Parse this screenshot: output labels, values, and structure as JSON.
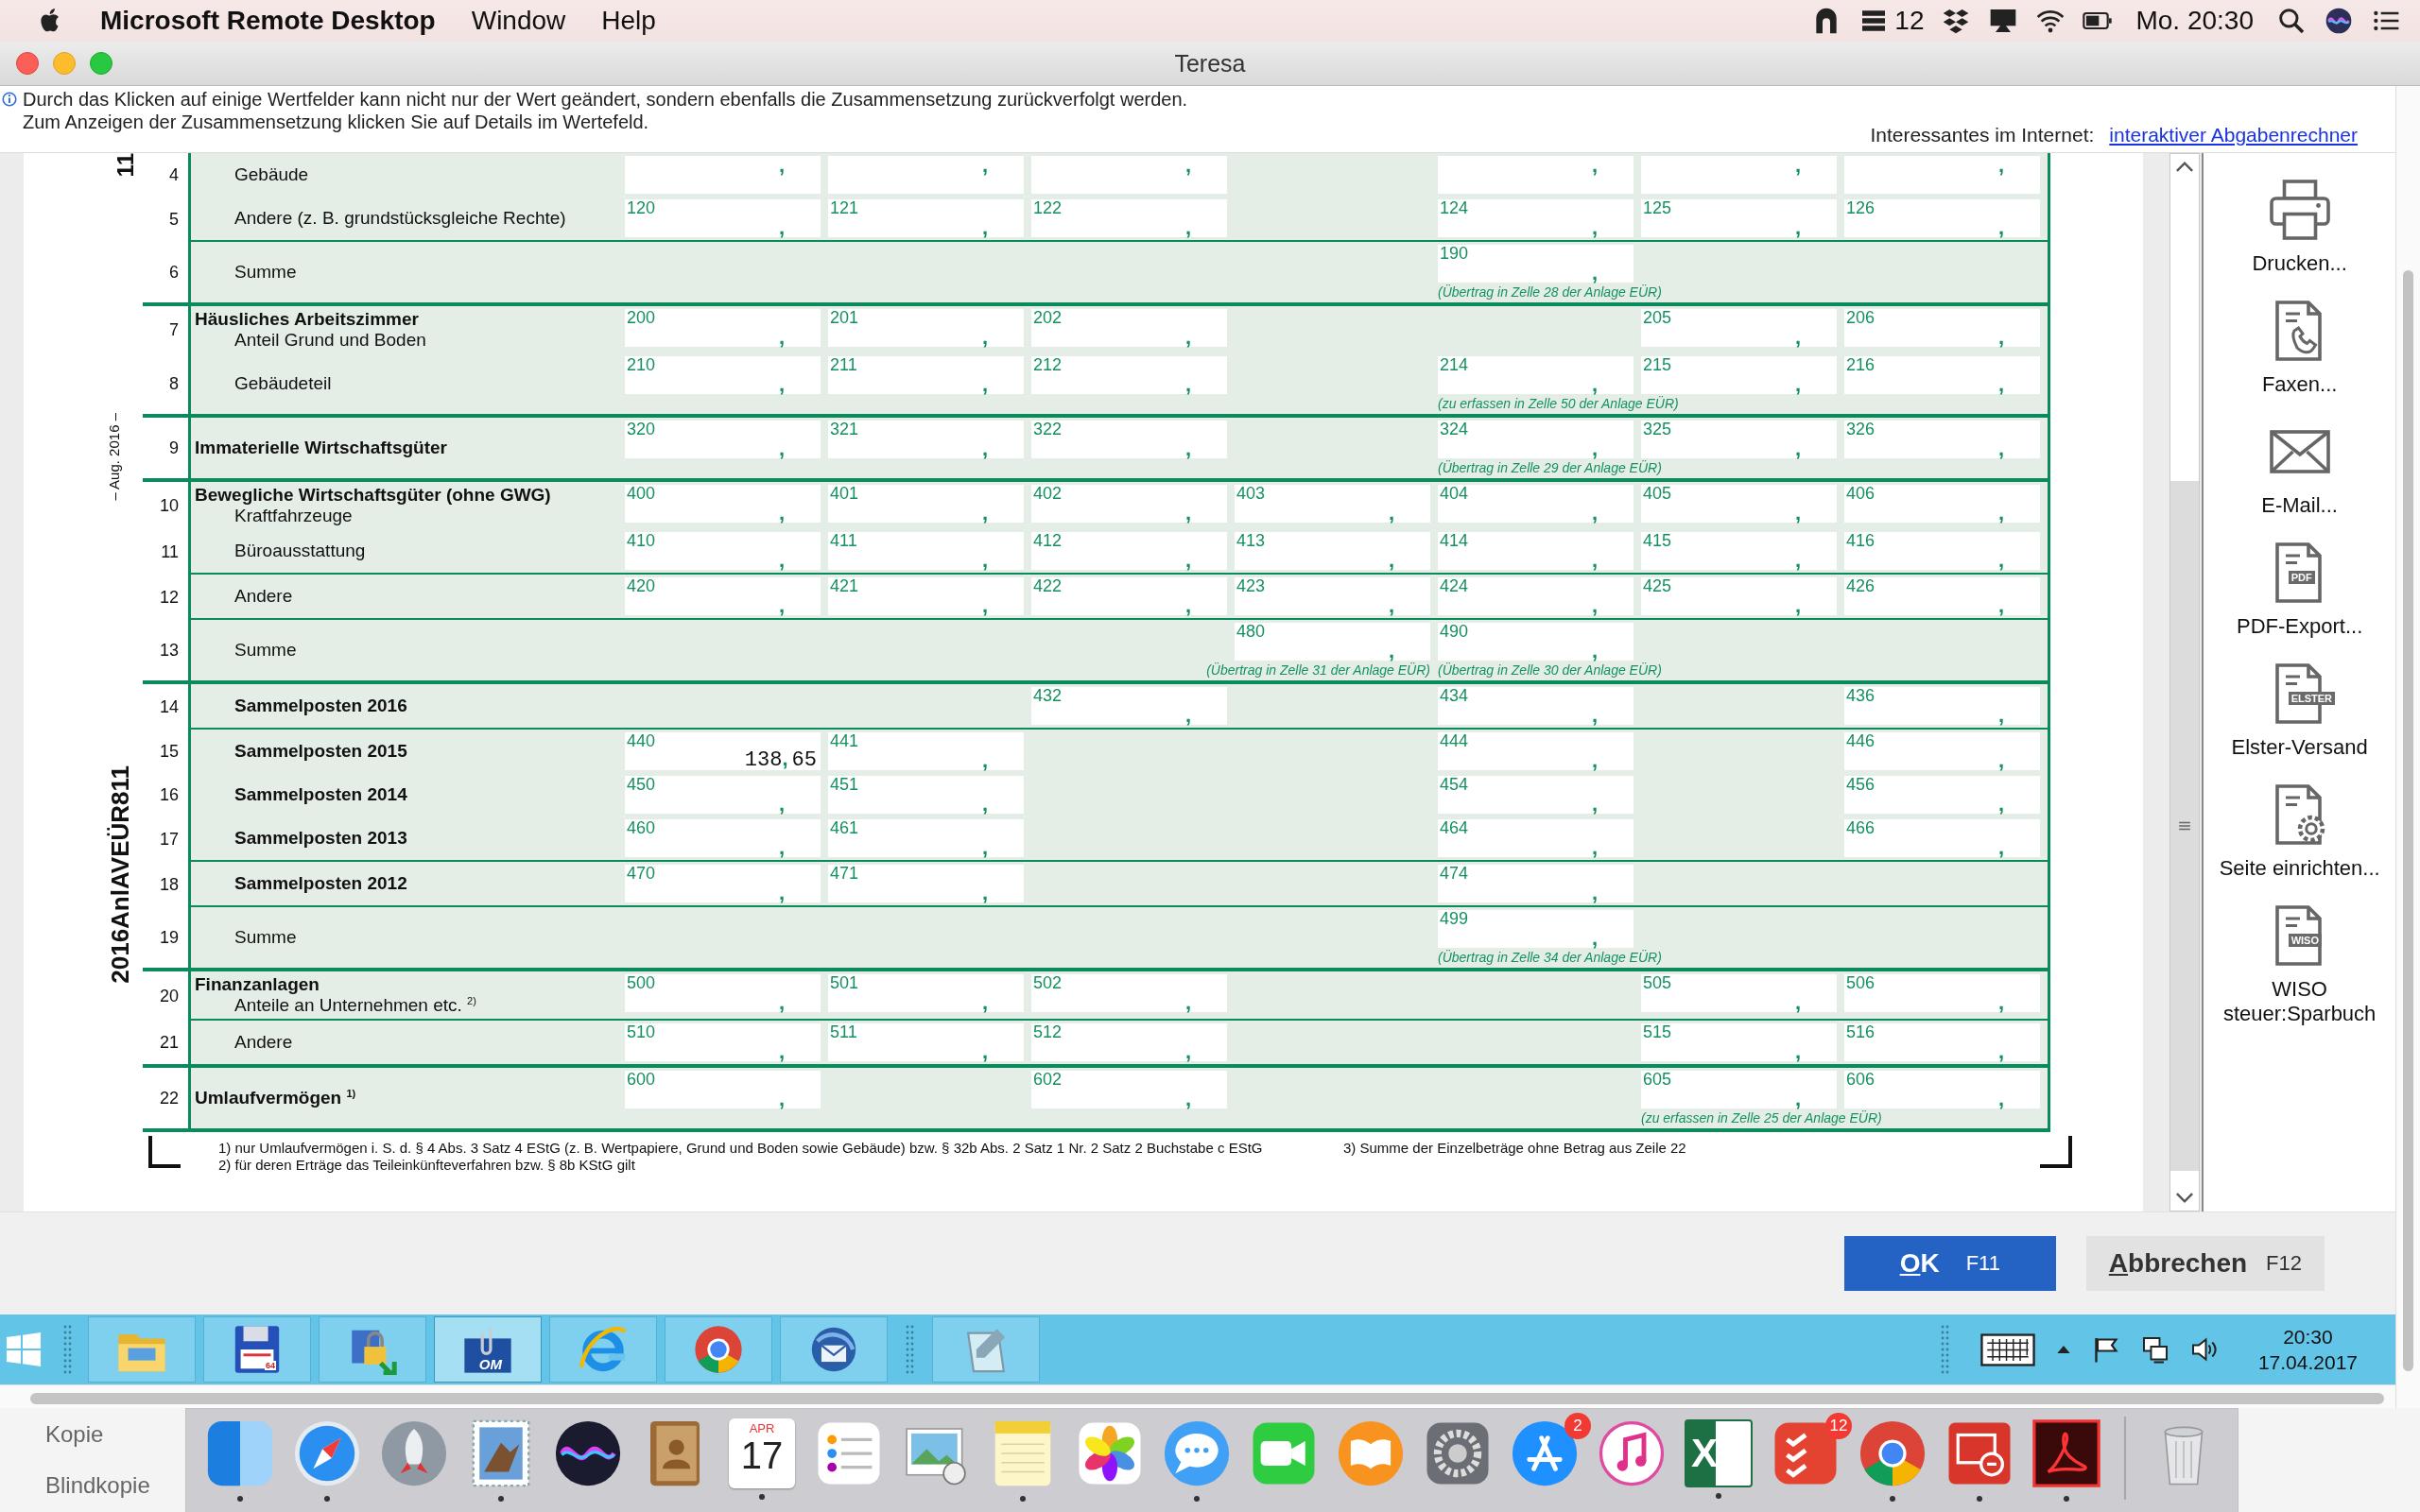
{
  "menubar": {
    "app": "Microsoft Remote Desktop",
    "menus": [
      "Window",
      "Help"
    ],
    "status": [
      {
        "kind": "arch"
      },
      {
        "kind": "stack",
        "text": "12"
      },
      {
        "kind": "dropbox"
      },
      {
        "kind": "display"
      },
      {
        "kind": "wifi"
      },
      {
        "kind": "battery"
      }
    ],
    "clock": "Mo. 20:30",
    "tray_end": [
      {
        "kind": "search"
      },
      {
        "kind": "siri"
      },
      {
        "kind": "list"
      }
    ]
  },
  "window": {
    "title": "Teresa"
  },
  "header": {
    "lines": [
      "Durch das Klicken auf einige Wertfelder kann nicht nur der Wert geändert, sondern ebenfalls die Zusammensetzung zurückverfolgt werden.",
      "Zum Anzeigen der Zusammensetzung klicken Sie auf Details im Wertefeld."
    ],
    "link_label": "Interessantes im Internet:",
    "link": "interaktiver Abgabenrechner"
  },
  "margin": {
    "top_mark": "11",
    "date": "– Aug. 2016 –",
    "form_id": "2016AnlAVEÜR811"
  },
  "sections": [
    {
      "rows": [
        {
          "no": "4",
          "kind": "item",
          "label": "Gebäude",
          "divider": false,
          "cells": [
            {
              "sep": ","
            },
            {
              "sep": ","
            },
            {
              "sep": ","
            },
            null,
            {
              "sep": ","
            },
            {
              "sep": ","
            },
            {
              "sep": ","
            }
          ]
        },
        {
          "no": "5",
          "kind": "item",
          "label": "Andere (z. B. grundstücksgleiche Rechte)",
          "divider": true,
          "cells": [
            {
              "code": "120",
              "sep": ","
            },
            {
              "code": "121",
              "sep": ","
            },
            {
              "code": "122",
              "sep": ","
            },
            null,
            {
              "code": "124",
              "sep": ","
            },
            {
              "code": "125",
              "sep": ","
            },
            {
              "code": "126",
              "sep": ","
            }
          ]
        },
        {
          "no": "6",
          "kind": "item",
          "label": "Summe",
          "divider": false,
          "cells": [
            null,
            null,
            null,
            null,
            {
              "code": "190",
              "sep": ",",
              "note": "(Übertrag in Zelle 28 der Anlage EÜR)"
            },
            null,
            null
          ]
        }
      ]
    },
    {
      "rows": [
        {
          "no": "7",
          "kind": "item",
          "heading": "Häusliches Arbeitszimmer",
          "label": "Anteil Grund und Boden",
          "divider": false,
          "cells": [
            {
              "code": "200",
              "sep": ","
            },
            {
              "code": "201",
              "sep": ","
            },
            {
              "code": "202",
              "sep": ","
            },
            null,
            null,
            {
              "code": "205",
              "sep": ","
            },
            {
              "code": "206",
              "sep": ","
            }
          ]
        },
        {
          "no": "8",
          "kind": "item",
          "label": "Gebäudeteil",
          "divider": false,
          "cells": [
            {
              "code": "210",
              "sep": ","
            },
            {
              "code": "211",
              "sep": ","
            },
            {
              "code": "212",
              "sep": ","
            },
            null,
            {
              "code": "214",
              "sep": ",",
              "note": "(zu erfassen in Zelle 50 der Anlage EÜR)"
            },
            {
              "code": "215",
              "sep": ","
            },
            {
              "code": "216",
              "sep": ","
            }
          ]
        }
      ]
    },
    {
      "rows": [
        {
          "no": "9",
          "kind": "title",
          "label": "Immaterielle Wirtschaftsgüter",
          "divider": false,
          "cells": [
            {
              "code": "320",
              "sep": ","
            },
            {
              "code": "321",
              "sep": ","
            },
            {
              "code": "322",
              "sep": ","
            },
            null,
            {
              "code": "324",
              "sep": ",",
              "note": "(Übertrag in Zelle 29 der Anlage EÜR)"
            },
            {
              "code": "325",
              "sep": ","
            },
            {
              "code": "326",
              "sep": ","
            }
          ]
        }
      ]
    },
    {
      "rows": [
        {
          "no": "10",
          "kind": "item",
          "heading": "Bewegliche Wirtschaftsgüter (ohne GWG)",
          "label": "Kraftfahrzeuge",
          "divider": false,
          "cells": [
            {
              "code": "400",
              "sep": ","
            },
            {
              "code": "401",
              "sep": ","
            },
            {
              "code": "402",
              "sep": ","
            },
            {
              "code": "403",
              "sep": ","
            },
            {
              "code": "404",
              "sep": ","
            },
            {
              "code": "405",
              "sep": ","
            },
            {
              "code": "406",
              "sep": ","
            }
          ]
        },
        {
          "no": "11",
          "kind": "item",
          "label": "Büroausstattung",
          "divider": true,
          "cells": [
            {
              "code": "410",
              "sep": ","
            },
            {
              "code": "411",
              "sep": ","
            },
            {
              "code": "412",
              "sep": ","
            },
            {
              "code": "413",
              "sep": ","
            },
            {
              "code": "414",
              "sep": ","
            },
            {
              "code": "415",
              "sep": ","
            },
            {
              "code": "416",
              "sep": ","
            }
          ]
        },
        {
          "no": "12",
          "kind": "item",
          "label": "Andere",
          "divider": true,
          "cells": [
            {
              "code": "420",
              "sep": ","
            },
            {
              "code": "421",
              "sep": ","
            },
            {
              "code": "422",
              "sep": ","
            },
            {
              "code": "423",
              "sep": ","
            },
            {
              "code": "424",
              "sep": ","
            },
            {
              "code": "425",
              "sep": ","
            },
            {
              "code": "426",
              "sep": ","
            }
          ]
        },
        {
          "no": "13",
          "kind": "item",
          "label": "Summe",
          "divider": false,
          "cells": [
            null,
            null,
            null,
            {
              "code": "480",
              "sep": ",",
              "note": "(Übertrag in Zelle 31 der Anlage EÜR)"
            },
            {
              "code": "490",
              "sep": ",",
              "note": "(Übertrag in Zelle 30 der Anlage EÜR)"
            },
            null,
            null
          ]
        }
      ]
    },
    {
      "rows": [
        {
          "no": "14",
          "kind": "group",
          "label": "Sammelposten 2016",
          "divider": true,
          "cells": [
            null,
            null,
            {
              "code": "432",
              "sep": ","
            },
            null,
            {
              "code": "434",
              "sep": ","
            },
            null,
            {
              "code": "436",
              "sep": ","
            }
          ]
        },
        {
          "no": "15",
          "kind": "group",
          "label": "Sammelposten 2015",
          "divider": false,
          "cells": [
            {
              "code": "440",
              "sep": ",",
              "euros": "138",
              "cents": "65"
            },
            {
              "code": "441",
              "sep": ","
            },
            null,
            null,
            {
              "code": "444",
              "sep": ","
            },
            null,
            {
              "code": "446",
              "sep": ","
            }
          ]
        },
        {
          "no": "16",
          "kind": "group",
          "label": "Sammelposten 2014",
          "divider": false,
          "cells": [
            {
              "code": "450",
              "sep": ","
            },
            {
              "code": "451",
              "sep": ","
            },
            null,
            null,
            {
              "code": "454",
              "sep": ","
            },
            null,
            {
              "code": "456",
              "sep": ","
            }
          ]
        },
        {
          "no": "17",
          "kind": "group",
          "label": "Sammelposten 2013",
          "divider": true,
          "cells": [
            {
              "code": "460",
              "sep": ","
            },
            {
              "code": "461",
              "sep": ","
            },
            null,
            null,
            {
              "code": "464",
              "sep": ","
            },
            null,
            {
              "code": "466",
              "sep": ","
            }
          ]
        },
        {
          "no": "18",
          "kind": "group",
          "label": "Sammelposten 2012",
          "divider": true,
          "cells": [
            {
              "code": "470",
              "sep": ","
            },
            {
              "code": "471",
              "sep": ","
            },
            null,
            null,
            {
              "code": "474",
              "sep": ","
            },
            null,
            null
          ]
        },
        {
          "no": "19",
          "kind": "item",
          "label": "Summe",
          "divider": false,
          "cells": [
            null,
            null,
            null,
            null,
            {
              "code": "499",
              "sep": ",",
              "note": "(Übertrag in Zelle 34 der Anlage EÜR)"
            },
            null,
            null
          ]
        }
      ]
    },
    {
      "rows": [
        {
          "no": "20",
          "kind": "item",
          "heading": "Finanzanlagen",
          "label": "Anteile an Unternehmen etc. $^{2)}$",
          "divider": true,
          "cells": [
            {
              "code": "500",
              "sep": ","
            },
            {
              "code": "501",
              "sep": ","
            },
            {
              "code": "502",
              "sep": ","
            },
            null,
            null,
            {
              "code": "505",
              "sep": ","
            },
            {
              "code": "506",
              "sep": ","
            }
          ]
        },
        {
          "no": "21",
          "kind": "item",
          "label": "Andere",
          "divider": false,
          "cells": [
            {
              "code": "510",
              "sep": ","
            },
            {
              "code": "511",
              "sep": ","
            },
            {
              "code": "512",
              "sep": ","
            },
            null,
            null,
            {
              "code": "515",
              "sep": ","
            },
            {
              "code": "516",
              "sep": ","
            }
          ]
        }
      ]
    },
    {
      "rows": [
        {
          "no": "22",
          "kind": "title",
          "label": "Umlaufvermögen $^{1)}$",
          "divider": false,
          "cells": [
            {
              "code": "600",
              "sep": ","
            },
            null,
            {
              "code": "602",
              "sep": ","
            },
            null,
            null,
            {
              "code": "605",
              "sep": ",",
              "note": "(zu erfassen in Zelle 25 der Anlage EÜR)"
            },
            {
              "code": "606",
              "sep": ","
            }
          ]
        }
      ]
    }
  ],
  "footnotes": [
    "1) nur Umlaufvermögen i. S. d. § 4 Abs. 3 Satz 4 EStG (z. B. Wertpapiere, Grund und Boden sowie Gebäude) bzw. § 32b Abs. 2 Satz 1 Nr. 2 Satz 2 Buchstabe c EStG",
    "2) für deren Erträge das Teileinkünfteverfahren bzw. § 8b KStG gilt",
    "3) Summe der Einzelbeträge ohne Betrag aus Zeile 22"
  ],
  "actions": [
    {
      "kind": "printer",
      "label": "Drucken..."
    },
    {
      "kind": "fax",
      "label": "Faxen..."
    },
    {
      "kind": "envelope",
      "label": "E-Mail..."
    },
    {
      "kind": "document",
      "tag": "PDF",
      "label": "PDF-Export..."
    },
    {
      "kind": "document",
      "tag": "ELSTER",
      "label": "Elster-Versand"
    },
    {
      "kind": "gear",
      "label": "Seite einrichten..."
    },
    {
      "kind": "document",
      "tag": "WISO",
      "label": "WISO steuer:Sparbuch"
    }
  ],
  "buttons": [
    {
      "kind": "primary",
      "label": "OK",
      "key": "F11"
    },
    {
      "kind": "secondary",
      "label": "Abbrechen",
      "key": "F12"
    }
  ],
  "taskbar": {
    "apps": [
      {
        "kind": "folder",
        "selected": false
      },
      {
        "kind": "floppy",
        "text": "64",
        "selected": false
      },
      {
        "kind": "lock",
        "selected": false
      },
      {
        "kind": "om",
        "text": "OM",
        "selected": true
      },
      {
        "kind": "ie",
        "selected": false
      },
      {
        "kind": "chrome",
        "selected": false
      },
      {
        "kind": "thunderbird",
        "selected": false
      },
      {
        "kind": "notepad",
        "selected": false
      }
    ],
    "tray": [
      {
        "kind": "keyboard"
      },
      {
        "kind": "caret"
      },
      {
        "kind": "flag"
      },
      {
        "kind": "network"
      },
      {
        "kind": "speaker"
      }
    ],
    "time": "20:30",
    "date": "17.04.2017"
  },
  "desktop": {
    "texts": [
      "Kopie",
      "Blindkopie"
    ]
  },
  "dock": [
    {
      "kind": "finder",
      "running": true
    },
    {
      "kind": "safari",
      "running": true
    },
    {
      "kind": "launchpad",
      "running": false
    },
    {
      "kind": "mail",
      "running": true
    },
    {
      "kind": "siri",
      "running": false
    },
    {
      "kind": "contacts",
      "running": false
    },
    {
      "kind": "calendar",
      "month": "APR",
      "day": "17",
      "running": true
    },
    {
      "kind": "reminders",
      "running": false
    },
    {
      "kind": "preview",
      "running": false
    },
    {
      "kind": "notes",
      "running": true
    },
    {
      "kind": "photos",
      "running": false
    },
    {
      "kind": "messages",
      "running": true
    },
    {
      "kind": "facetime",
      "running": false
    },
    {
      "kind": "books",
      "running": false
    },
    {
      "kind": "prefs",
      "running": false
    },
    {
      "kind": "appstore",
      "badge": "2",
      "running": false
    },
    {
      "kind": "music",
      "running": false
    },
    {
      "kind": "excel",
      "letter": "X",
      "running": true
    },
    {
      "kind": "todo",
      "badge": "12",
      "running": false
    },
    {
      "kind": "chrome",
      "running": true
    },
    {
      "kind": "remote",
      "running": true
    },
    {
      "kind": "acrobat",
      "running": true
    },
    {
      "kind": "trash",
      "divider": true,
      "running": false
    }
  ]
}
